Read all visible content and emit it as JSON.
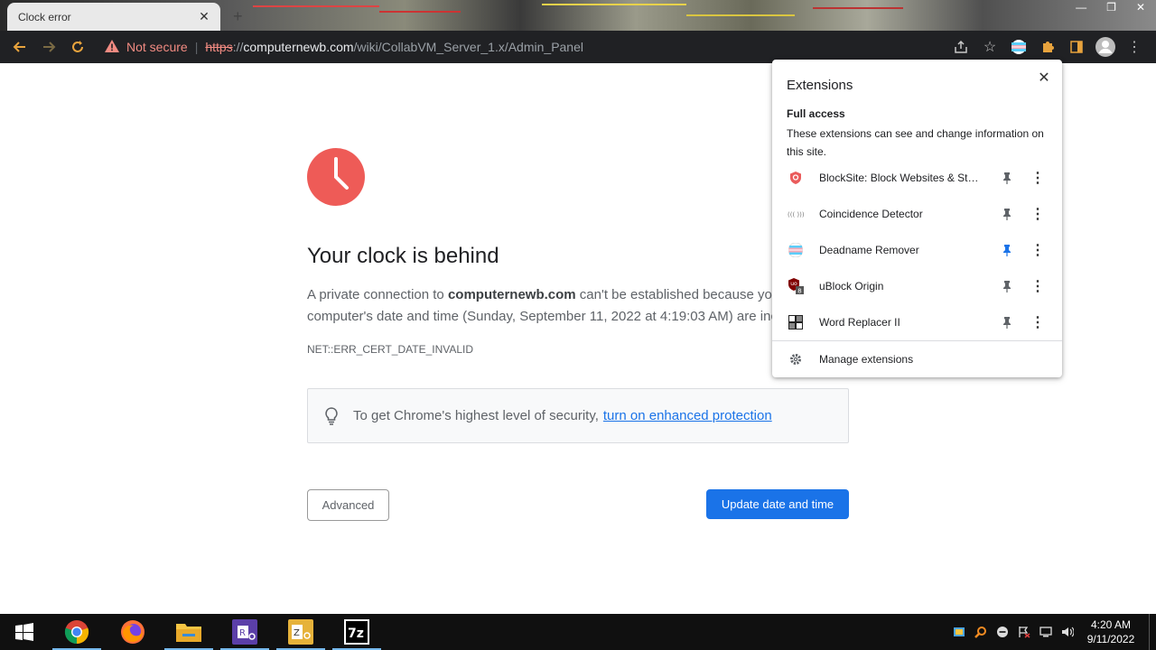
{
  "browser": {
    "tab_title": "Clock error",
    "tab_close": "✕",
    "new_tab": "+",
    "security_label": "Not secure",
    "url_scheme": "https",
    "url_sep": "://",
    "url_host": "computernewb.com",
    "url_path": "/wiki/CollabVM_Server_1.x/Admin_Panel"
  },
  "page": {
    "headline": "Your clock is behind",
    "desc_pre": "A private connection to ",
    "desc_host": "computernewb.com",
    "desc_mid": " can't be established because your",
    "desc_line2": "computer's date and time (Sunday, September 11, 2022 at 4:19:03 AM) are incorrect.",
    "error_code": "NET::ERR_CERT_DATE_INVALID",
    "tip_text": "To get Chrome's highest level of security,",
    "tip_link": "turn on enhanced protection",
    "advanced_label": "Advanced",
    "update_label": "Update date and time"
  },
  "extensions": {
    "title": "Extensions",
    "close": "✕",
    "section": "Full access",
    "section_desc": "These extensions can see and change information on this site.",
    "items": [
      {
        "name": "BlockSite: Block Websites & Sta...",
        "pinned": false,
        "icon": "blocksite-icon"
      },
      {
        "name": "Coincidence Detector",
        "pinned": false,
        "icon": "coincidence-detector-icon"
      },
      {
        "name": "Deadname Remover",
        "pinned": true,
        "icon": "deadname-remover-icon"
      },
      {
        "name": "uBlock Origin",
        "pinned": false,
        "icon": "ublock-origin-icon",
        "badge": "8"
      },
      {
        "name": "Word Replacer II",
        "pinned": false,
        "icon": "word-replacer-icon"
      }
    ],
    "manage": "Manage extensions"
  },
  "taskbar": {
    "time": "4:20 AM",
    "date": "9/11/2022",
    "apps": [
      "chrome",
      "firefox",
      "file-explorer",
      "rdp-app",
      "zotero",
      "7-zip"
    ]
  },
  "colors": {
    "accent": "#1a73e8",
    "error_red": "#ee5b57",
    "warning": "#f28b82",
    "toolbar": "#202124"
  }
}
